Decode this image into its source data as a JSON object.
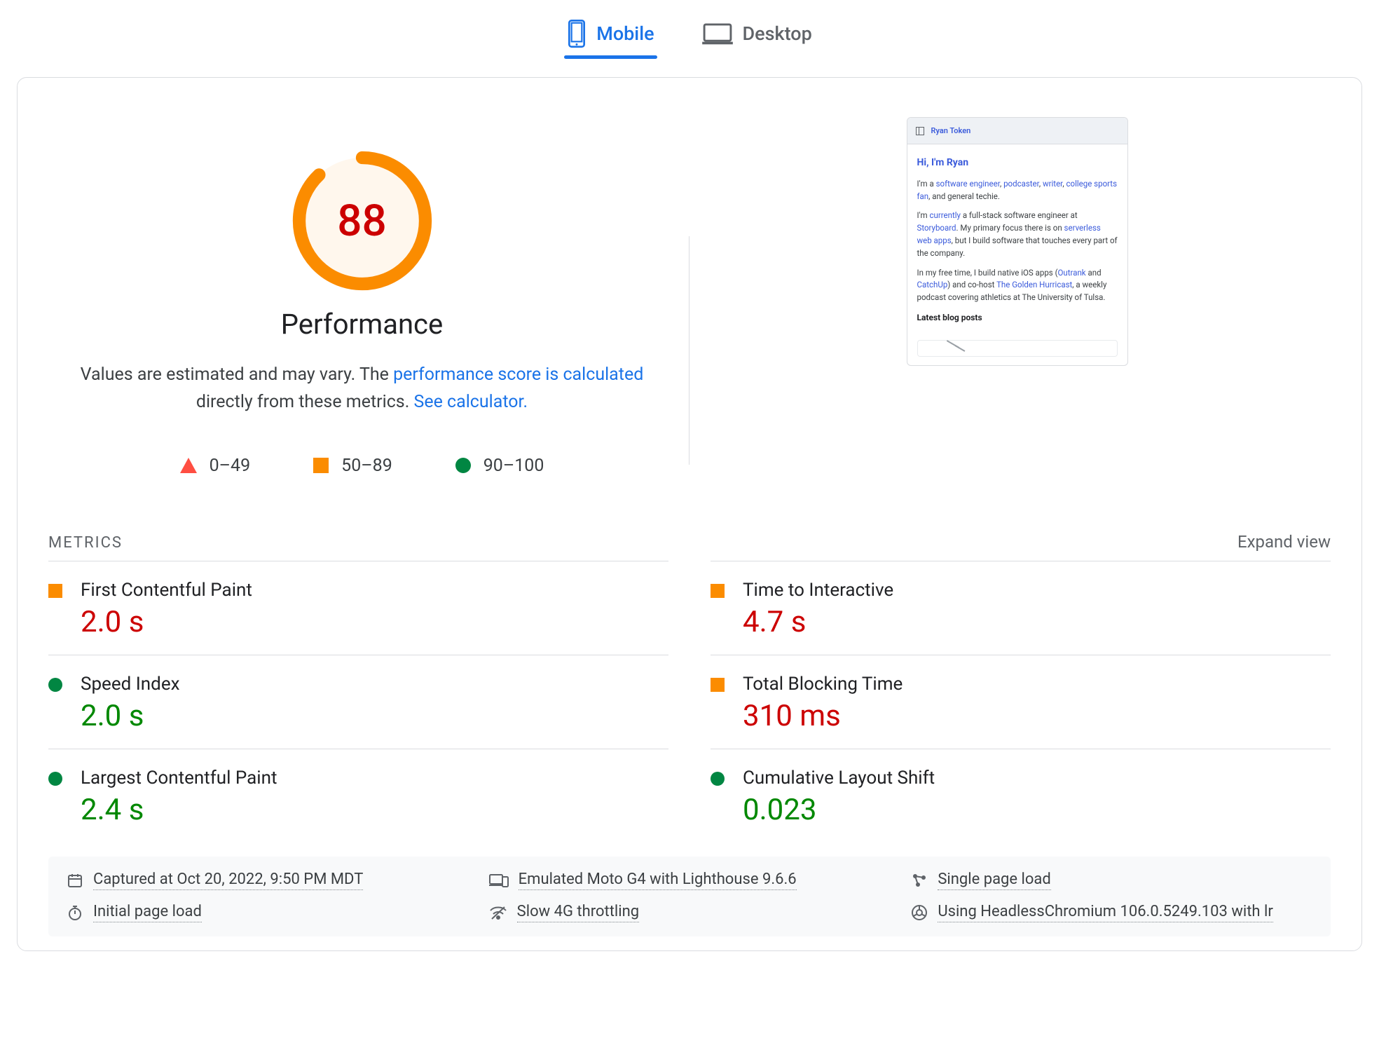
{
  "tabs": {
    "mobile": "Mobile",
    "desktop": "Desktop"
  },
  "score": {
    "value": "88",
    "title": "Performance",
    "desc1": "Values are estimated and may vary. The ",
    "link1": "performance score is calculated",
    "desc2": " directly from these metrics. ",
    "link2": "See calculator."
  },
  "legend": {
    "r0": "0–49",
    "r1": "50–89",
    "r2": "90–100"
  },
  "preview": {
    "author": "Ryan Token",
    "greeting": "Hi, I'm Ryan",
    "p1a": "I'm a ",
    "p1_link1": "software engineer",
    "p1_sep1": ", ",
    "p1_link2": "podcaster",
    "p1_sep2": ", ",
    "p1_link3": "writer",
    "p1_sep3": ", ",
    "p1_link4": "college sports fan",
    "p1b": ", and general techie.",
    "p2a": "I'm ",
    "p2_link1": "currently",
    "p2b": " a full-stack software engineer at ",
    "p2_link2": "Storyboard",
    "p2c": ". My primary focus there is on ",
    "p2_link3": "serverless web apps",
    "p2d": ", but I build software that touches every part of the company.",
    "p3a": "In my free time, I build native iOS apps (",
    "p3_link1": "Outrank",
    "p3_sep1": " and ",
    "p3_link2": "CatchUp",
    "p3b": ") and co-host ",
    "p3_link3": "The Golden Hurricast",
    "p3c": ", a weekly podcast covering athletics at The University of Tulsa.",
    "latest": "Latest blog posts"
  },
  "metrics_header": {
    "title": "METRICS",
    "expand": "Expand view"
  },
  "metrics": {
    "fcp_name": "First Contentful Paint",
    "fcp_val": "2.0 s",
    "si_name": "Speed Index",
    "si_val": "2.0 s",
    "lcp_name": "Largest Contentful Paint",
    "lcp_val": "2.4 s",
    "tti_name": "Time to Interactive",
    "tti_val": "4.7 s",
    "tbt_name": "Total Blocking Time",
    "tbt_val": "310 ms",
    "cls_name": "Cumulative Layout Shift",
    "cls_val": "0.023"
  },
  "env": {
    "captured": "Captured at Oct 20, 2022, 9:50 PM MDT",
    "emulated": "Emulated Moto G4 with Lighthouse 9.6.6",
    "single": "Single page load",
    "initial": "Initial page load",
    "slow4g": "Slow 4G throttling",
    "chrome": "Using HeadlessChromium 106.0.5249.103 with lr"
  },
  "chart_data": {
    "type": "bar",
    "title": "Performance",
    "categories": [
      "Performance score"
    ],
    "values": [
      88
    ],
    "ylim": [
      0,
      100
    ],
    "legend_ranges": [
      {
        "range": "0–49",
        "status": "fail"
      },
      {
        "range": "50–89",
        "status": "average"
      },
      {
        "range": "90–100",
        "status": "pass"
      }
    ],
    "metrics": [
      {
        "name": "First Contentful Paint",
        "value": 2.0,
        "unit": "s",
        "status": "average"
      },
      {
        "name": "Speed Index",
        "value": 2.0,
        "unit": "s",
        "status": "pass"
      },
      {
        "name": "Largest Contentful Paint",
        "value": 2.4,
        "unit": "s",
        "status": "pass"
      },
      {
        "name": "Time to Interactive",
        "value": 4.7,
        "unit": "s",
        "status": "average"
      },
      {
        "name": "Total Blocking Time",
        "value": 310,
        "unit": "ms",
        "status": "average"
      },
      {
        "name": "Cumulative Layout Shift",
        "value": 0.023,
        "unit": "",
        "status": "pass"
      }
    ]
  }
}
